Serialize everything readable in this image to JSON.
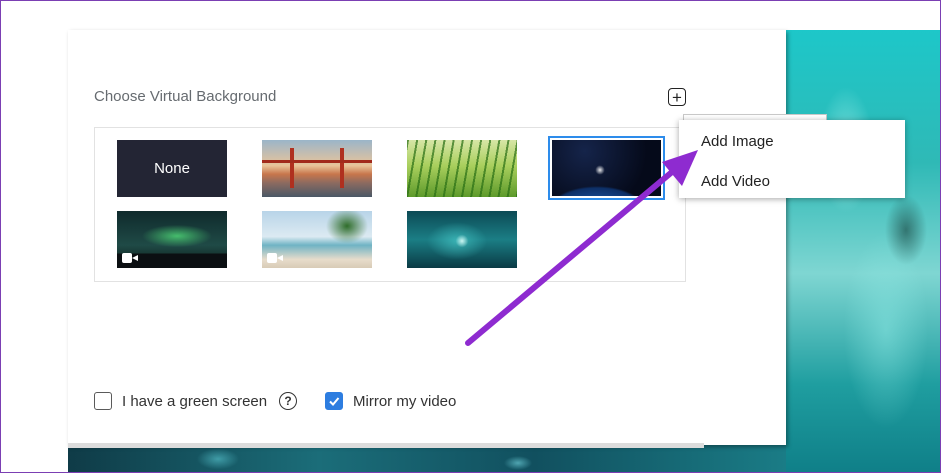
{
  "virtual_background": {
    "section_title": "Choose Virtual Background",
    "add_icon": "plus-square-icon",
    "thumbnails": [
      {
        "label": "None",
        "kind": "none"
      },
      {
        "label": "",
        "kind": "golden-gate-bridge"
      },
      {
        "label": "",
        "kind": "grass"
      },
      {
        "label": "",
        "kind": "earth-from-space",
        "selected": true
      },
      {
        "label": "",
        "kind": "aurora",
        "video": true
      },
      {
        "label": "",
        "kind": "beach",
        "video": true
      },
      {
        "label": "",
        "kind": "underwater-forest"
      }
    ]
  },
  "context_menu": {
    "items": [
      "Add Image",
      "Add Video"
    ]
  },
  "options": {
    "green_screen_label": "I have a green screen",
    "green_screen_checked": false,
    "mirror_label": "Mirror my video",
    "mirror_checked": true,
    "help_icon": "question-circle-icon"
  },
  "annotation": {
    "arrow_color": "#8e2bd0"
  },
  "colors": {
    "accent": "#2d7de0",
    "none_tile": "#232534"
  }
}
